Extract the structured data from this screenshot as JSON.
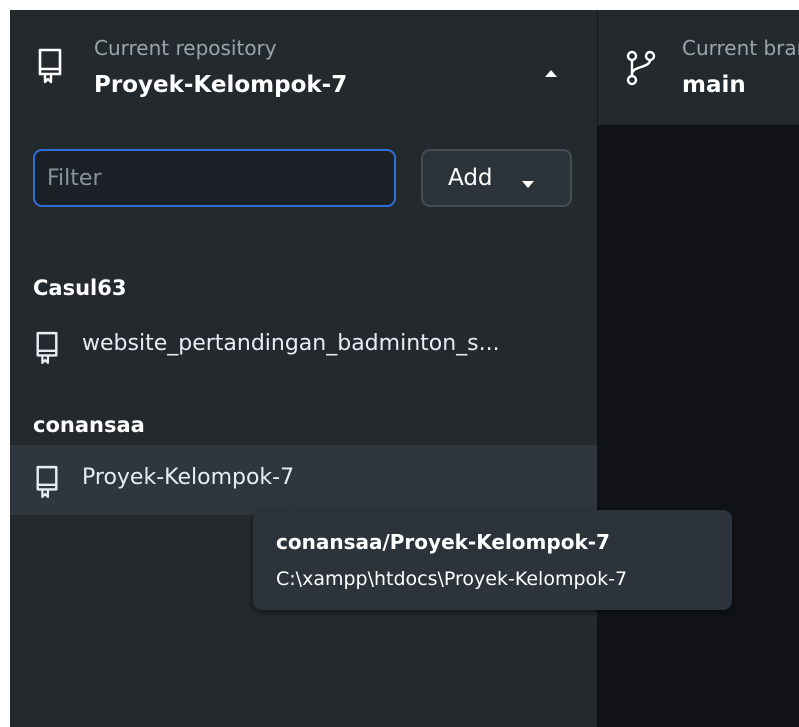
{
  "header": {
    "repository": {
      "label": "Current repository",
      "value": "Proyek-Kelompok-7",
      "icon": "repo-icon"
    },
    "branch": {
      "label": "Current branch",
      "value": "main",
      "icon": "git-branch-icon"
    }
  },
  "panel": {
    "filter_placeholder": "Filter",
    "filter_value": "",
    "add_label": "Add",
    "groups": [
      {
        "owner": "Casul63",
        "repos": [
          {
            "name": "website_pertandingan_badminton_s...",
            "selected": false
          }
        ]
      },
      {
        "owner": "conansaa",
        "repos": [
          {
            "name": "Proyek-Kelompok-7",
            "selected": true
          }
        ]
      }
    ]
  },
  "tooltip": {
    "title": "conansaa/Proyek-Kelompok-7",
    "path": "C:\\xampp\\htdocs\\Proyek-Kelompok-7"
  },
  "colors": {
    "accent": "#2f6fd6",
    "panel_bg": "#24292e",
    "selected_bg": "#30363d"
  }
}
